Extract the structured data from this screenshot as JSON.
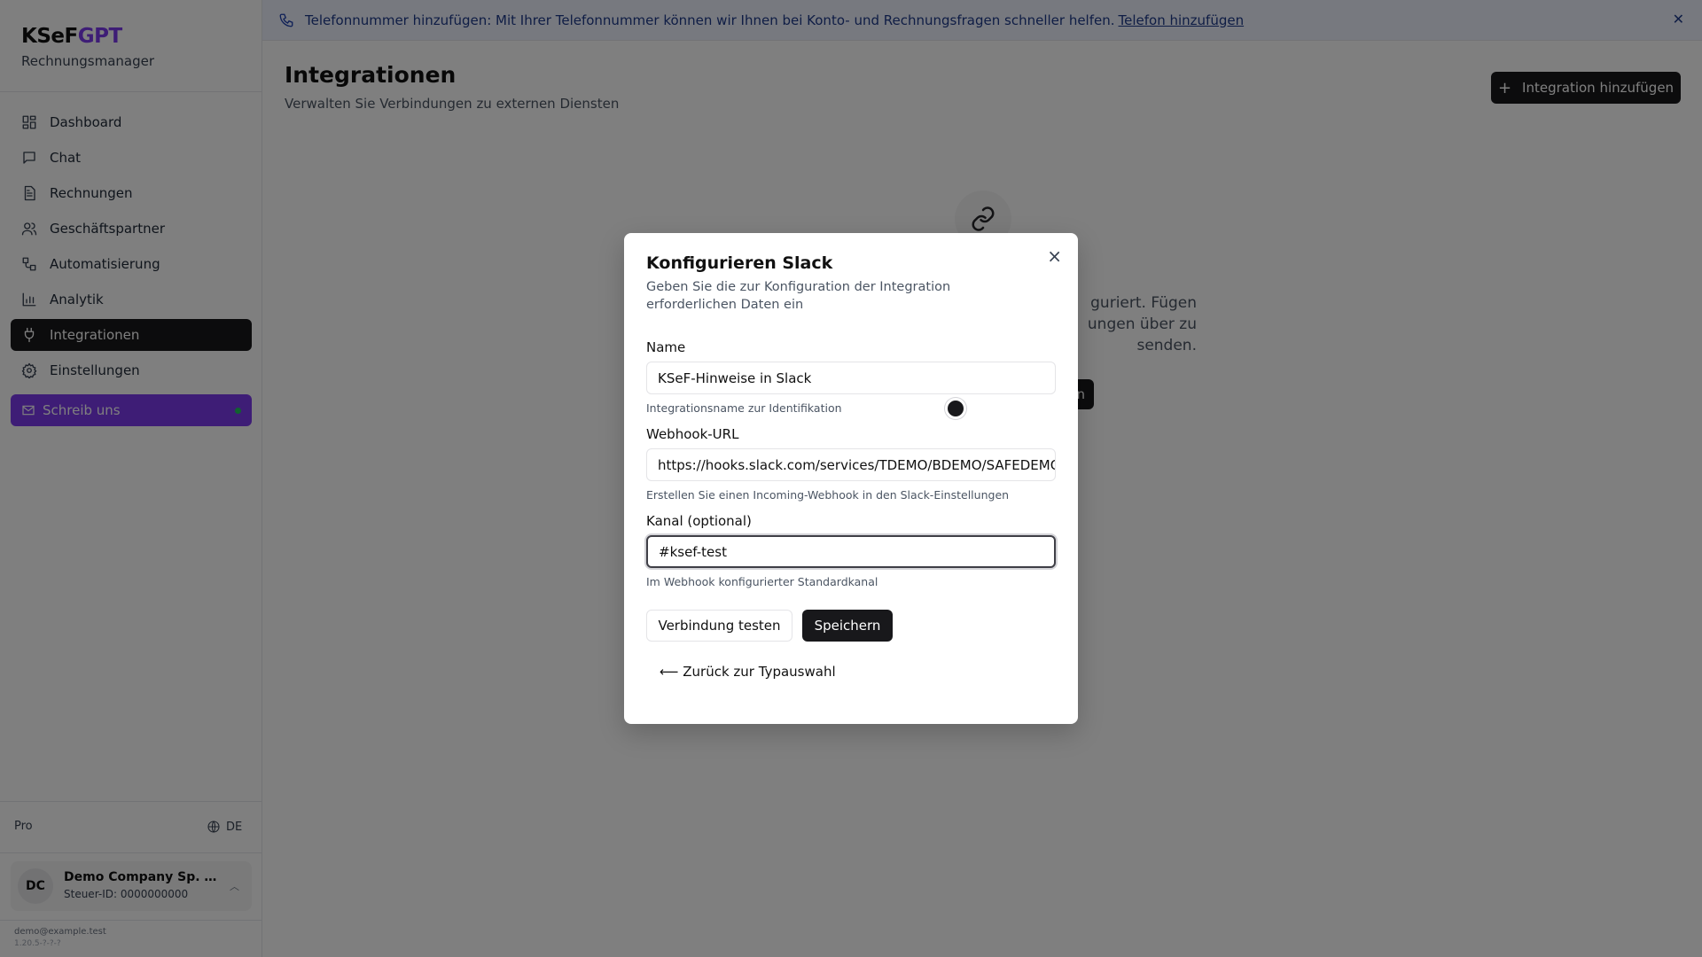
{
  "brand": {
    "logo_main": "KSeF",
    "logo_accent": "GPT",
    "subtitle": "Rechnungsmanager",
    "accent_color": "#7c3aed"
  },
  "sidebar": {
    "items": [
      {
        "label": "Dashboard",
        "icon": "dashboard-icon"
      },
      {
        "label": "Chat",
        "icon": "chat-icon"
      },
      {
        "label": "Rechnungen",
        "icon": "invoice-icon"
      },
      {
        "label": "Geschäftspartner",
        "icon": "users-icon"
      },
      {
        "label": "Automatisierung",
        "icon": "workflow-icon"
      },
      {
        "label": "Analytik",
        "icon": "chart-icon"
      },
      {
        "label": "Integrationen",
        "icon": "plug-icon",
        "active": true
      },
      {
        "label": "Einstellungen",
        "icon": "gear-icon"
      }
    ],
    "write_us": "Schreib uns",
    "plan": "Pro",
    "language": "DE",
    "account": {
      "initials": "DC",
      "name": "Demo Company Sp. z o...",
      "tax_id": "Steuer-ID: 0000000000"
    },
    "email": "demo@example.test",
    "version": "1.20.5-?-?-?"
  },
  "banner": {
    "text": "Telefonnummer hinzufügen: Mit Ihrer Telefonnummer können wir Ihnen bei Konto- und Rechnungsfragen schneller helfen.",
    "link": "Telefon hinzufügen"
  },
  "main": {
    "title": "Integrationen",
    "subtitle": "Verwalten Sie Verbindungen zu externen Diensten",
    "add_button": "Integration hinzufügen",
    "empty_text": "guriert. Fügen ungen über zu senden.",
    "empty_button": "n"
  },
  "modal": {
    "title": "Konfigurieren Slack",
    "description": "Geben Sie die zur Konfiguration der Integration erforderlichen Daten ein",
    "name_label": "Name",
    "name_value": "KSeF-Hinweise in Slack",
    "name_help": "Integrationsname zur Identifikation",
    "webhook_label": "Webhook-URL",
    "webhook_value": "https://hooks.slack.com/services/TDEMO/BDEMO/SAFEDEMO",
    "webhook_help": "Erstellen Sie einen Incoming-Webhook in den Slack-Einstellungen",
    "channel_label": "Kanal (optional)",
    "channel_value": "#ksef-test",
    "channel_help": "Im Webhook konfigurierter Standardkanal",
    "test_button": "Verbindung testen",
    "save_button": "Speichern",
    "back_link": "⟵ Zurück zur Typauswahl"
  }
}
